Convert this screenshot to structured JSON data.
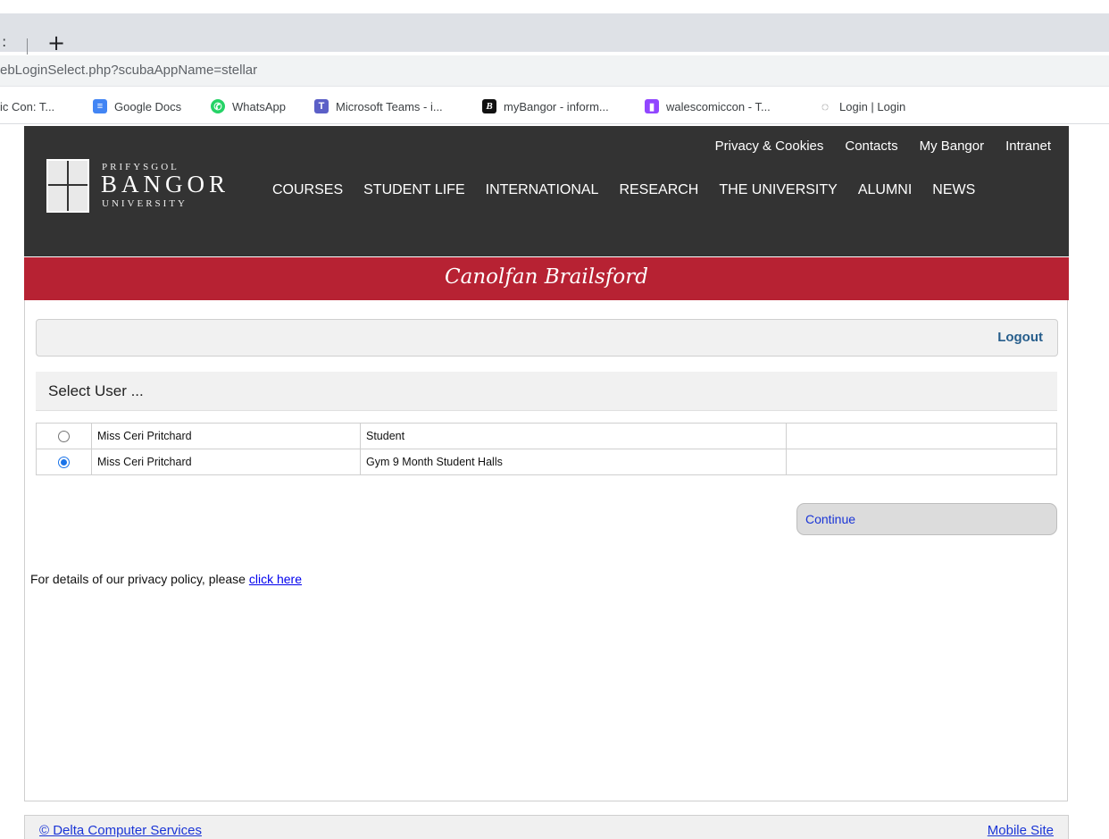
{
  "browser": {
    "tab_edge": ":",
    "new_tab": "+",
    "url": "ebLoginSelect.php?scubaAppName=stellar",
    "bookmarks": [
      {
        "label": "ic Con: T...",
        "icon": "partial"
      },
      {
        "label": "Google Docs",
        "icon": "google-docs-icon",
        "color": "#4285f4"
      },
      {
        "label": "WhatsApp",
        "icon": "whatsapp-icon",
        "color": "#25d366"
      },
      {
        "label": "Microsoft Teams - i...",
        "icon": "teams-icon",
        "color": "#5b5fc7"
      },
      {
        "label": "myBangor - inform...",
        "icon": "mybangor-icon",
        "color": "#111111"
      },
      {
        "label": "walescomiccon - T...",
        "icon": "twitch-icon",
        "color": "#9146ff"
      },
      {
        "label": "Login | Login",
        "icon": "login-icon",
        "color": "#555555"
      }
    ]
  },
  "header": {
    "logo": {
      "line1": "PRIFYSGOL",
      "line2": "BANGOR",
      "line3": "UNIVERSITY"
    },
    "top_links": [
      "Privacy & Cookies",
      "Contacts",
      "My Bangor",
      "Intranet"
    ],
    "main_nav": [
      "COURSES",
      "STUDENT LIFE",
      "INTERNATIONAL",
      "RESEARCH",
      "THE UNIVERSITY",
      "ALUMNI",
      "NEWS"
    ]
  },
  "banner": {
    "title": "Canolfan Brailsford"
  },
  "logout_label": "Logout",
  "select_heading": "Select User ...",
  "users": [
    {
      "name": "Miss Ceri Pritchard",
      "type": "Student",
      "extra": "",
      "selected": false
    },
    {
      "name": "Miss Ceri Pritchard",
      "type": "Gym 9 Month Student Halls",
      "extra": "",
      "selected": true
    }
  ],
  "continue_label": "Continue",
  "privacy": {
    "text": "For details of our privacy policy, please ",
    "link": "click here"
  },
  "footer": {
    "left": "© Delta Computer Services",
    "right": "Mobile Site"
  }
}
